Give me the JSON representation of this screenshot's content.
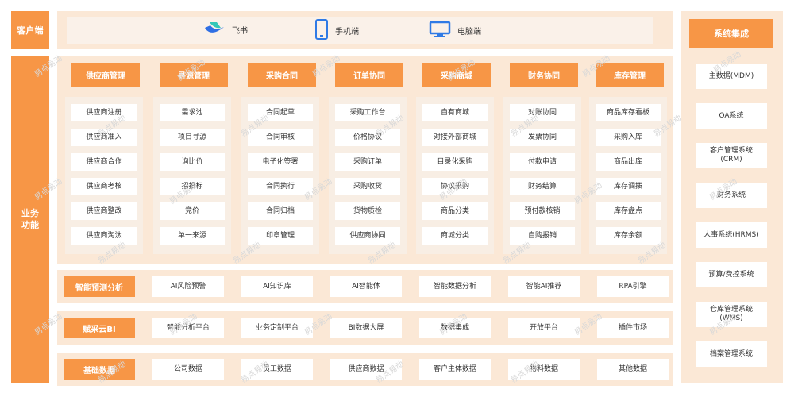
{
  "sections": {
    "client": "客户端",
    "business": "业务\n功能",
    "system": "系统集成"
  },
  "client_items": [
    {
      "label": "飞书",
      "icon": "feishu-icon"
    },
    {
      "label": "手机端",
      "icon": "phone-icon"
    },
    {
      "label": "电脑端",
      "icon": "desktop-icon"
    }
  ],
  "modules": [
    {
      "title": "供应商管理",
      "items": [
        "供应商注册",
        "供应商准入",
        "供应商合作",
        "供应商考核",
        "供应商整改",
        "供应商淘汰"
      ]
    },
    {
      "title": "寻源管理",
      "items": [
        "需求池",
        "项目寻源",
        "询比价",
        "招投标",
        "竞价",
        "单一来源"
      ]
    },
    {
      "title": "采购合同",
      "items": [
        "合同起草",
        "合同审核",
        "电子化签署",
        "合同执行",
        "合同归档",
        "印章管理"
      ]
    },
    {
      "title": "订单协同",
      "items": [
        "采购工作台",
        "价格协议",
        "采购订单",
        "采购收货",
        "货物质检",
        "供应商协同"
      ]
    },
    {
      "title": "采购商城",
      "items": [
        "自有商城",
        "对接外部商城",
        "目录化采购",
        "协议采购",
        "商品分类",
        "商城分类"
      ]
    },
    {
      "title": "财务协同",
      "items": [
        "对账协同",
        "发票协同",
        "付款申请",
        "财务结算",
        "预付款核销",
        "自购报销"
      ]
    },
    {
      "title": "库存管理",
      "items": [
        "商品库存看板",
        "采购入库",
        "商品出库",
        "库存调拨",
        "库存盘点",
        "库存余额"
      ]
    }
  ],
  "rows": [
    {
      "title": "智能预测分析",
      "items": [
        "AI风险预警",
        "AI知识库",
        "AI智能体",
        "智能数据分析",
        "智能AI推荐",
        "RPA引擎"
      ]
    },
    {
      "title": "赋采云BI",
      "items": [
        "智能分析平台",
        "业务定制平台",
        "BI数据大屏",
        "数据集成",
        "开放平台",
        "插件市场"
      ]
    },
    {
      "title": "基础数据",
      "items": [
        "公司数据",
        "员工数据",
        "供应商数据",
        "客户主体数据",
        "物料数据",
        "其他数据"
      ]
    }
  ],
  "system_items": [
    "主数据(MDM)",
    "OA系统",
    "客户管理系统\n(CRM)",
    "财务系统",
    "人事系统(HRMS)",
    "预算/费控系统",
    "仓库管理系统\n(WMS)",
    "档案管理系统"
  ],
  "watermark": "易点易动",
  "colors": {
    "accent": "#f79646",
    "panel": "#fbe8d6",
    "inner": "#f8eee4"
  }
}
